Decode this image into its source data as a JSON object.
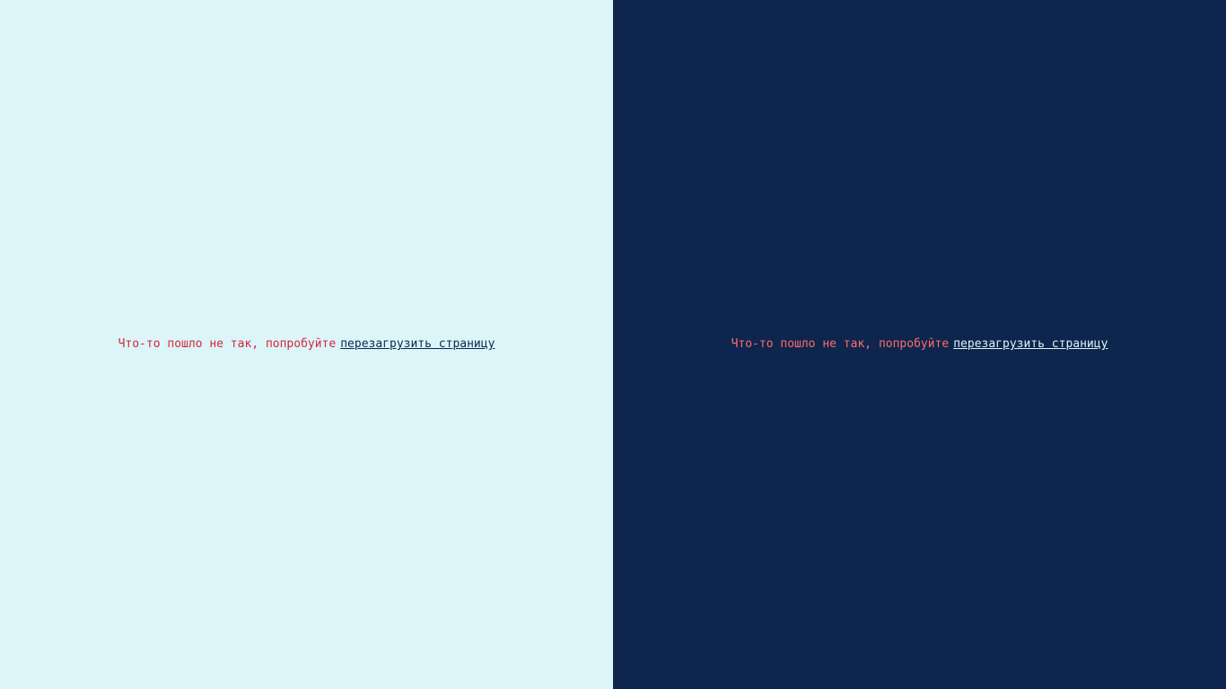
{
  "light_panel": {
    "message": "Что-то пошло не так, попробуйте",
    "link_label": "перезагрузить страницу"
  },
  "dark_panel": {
    "message": "Что-то пошло не так, попробуйте",
    "link_label": "перезагрузить страницу"
  },
  "colors": {
    "light_background": "#dbf5f8",
    "dark_background": "#0e264d",
    "light_error_text": "#d7263d",
    "dark_error_text": "#ff6b6b",
    "light_link": "#0e264d",
    "dark_link": "#dbf5f8"
  }
}
